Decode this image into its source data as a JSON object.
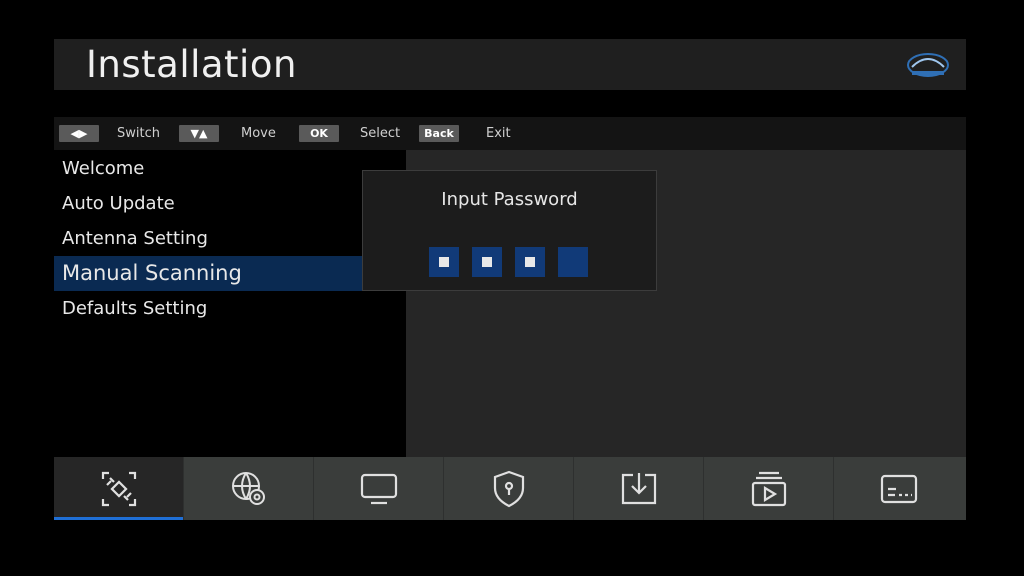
{
  "header": {
    "title": "Installation"
  },
  "hints": [
    {
      "key": "◀▶",
      "label": "Switch"
    },
    {
      "key": "▼▲",
      "label": "Move"
    },
    {
      "key": "OK",
      "label": "Select"
    },
    {
      "key": "Back",
      "label": "Exit"
    }
  ],
  "menu": {
    "items": [
      {
        "label": "Welcome"
      },
      {
        "label": "Auto Update"
      },
      {
        "label": "Antenna Setting"
      },
      {
        "label": "Manual Scanning"
      },
      {
        "label": "Defaults Setting"
      }
    ],
    "selected_index": 3
  },
  "dialog": {
    "title": "Input Password",
    "digits_total": 4,
    "digits_entered": 3
  },
  "bottom_tabs": [
    {
      "icon": "satellite-icon",
      "active": true
    },
    {
      "icon": "globe-gear-icon",
      "active": false
    },
    {
      "icon": "monitor-icon",
      "active": false
    },
    {
      "icon": "shield-lock-icon",
      "active": false
    },
    {
      "icon": "download-icon",
      "active": false
    },
    {
      "icon": "media-playlist-icon",
      "active": false
    },
    {
      "icon": "subtitle-icon",
      "active": false
    }
  ],
  "colors": {
    "accent": "#1f6fd6",
    "selected_row": "#0a2a52",
    "password_box": "#113a78"
  }
}
